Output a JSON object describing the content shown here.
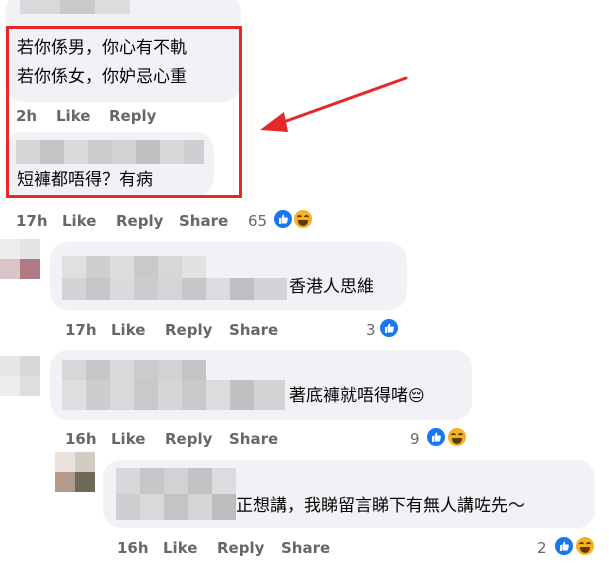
{
  "thread": {
    "comment1": {
      "lines": [
        "若你係男，你心有不軌",
        "若你係女，你妒忌心重"
      ],
      "time": "2h",
      "like_label": "Like",
      "reply_label": "Reply"
    },
    "comment2": {
      "text": "短褲都唔得？有病",
      "time": "17h",
      "like_label": "Like",
      "reply_label": "Reply",
      "share_label": "Share",
      "reaction_count": "65",
      "reactions": [
        "like-icon",
        "haha-icon"
      ]
    },
    "comment3": {
      "text": "香港人思維",
      "time": "17h",
      "like_label": "Like",
      "reply_label": "Reply",
      "share_label": "Share",
      "reaction_count": "3",
      "reactions": [
        "like-icon"
      ]
    },
    "comment4": {
      "text": "著底褲就唔得啫",
      "emoji": "😔",
      "time": "16h",
      "like_label": "Like",
      "reply_label": "Reply",
      "share_label": "Share",
      "reaction_count": "9",
      "reactions": [
        "like-icon",
        "haha-icon"
      ]
    },
    "comment5": {
      "text": "正想講，我睇留言睇下有無人講咗先～",
      "time": "16h",
      "like_label": "Like",
      "reply_label": "Reply",
      "share_label": "Share",
      "reaction_count": "2",
      "reactions": [
        "like-icon",
        "haha-icon"
      ]
    }
  },
  "annotation": {
    "box_color": "#e5282a",
    "arrow_color": "#e5282a"
  }
}
